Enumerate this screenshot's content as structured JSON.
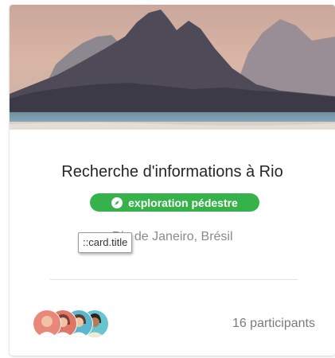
{
  "card": {
    "title": "Recherche d'informations à Rio",
    "badge": {
      "label": "exploration pédestre",
      "icon": "compass-icon",
      "color": "#35b34a"
    },
    "location": "Rio de Janeiro, Brésil",
    "tooltip": "::card.title",
    "participants_label": "16 participants",
    "avatar_colors": [
      "#e9877a",
      "#e07666",
      "#5bb6cf",
      "#66c6cf"
    ]
  }
}
